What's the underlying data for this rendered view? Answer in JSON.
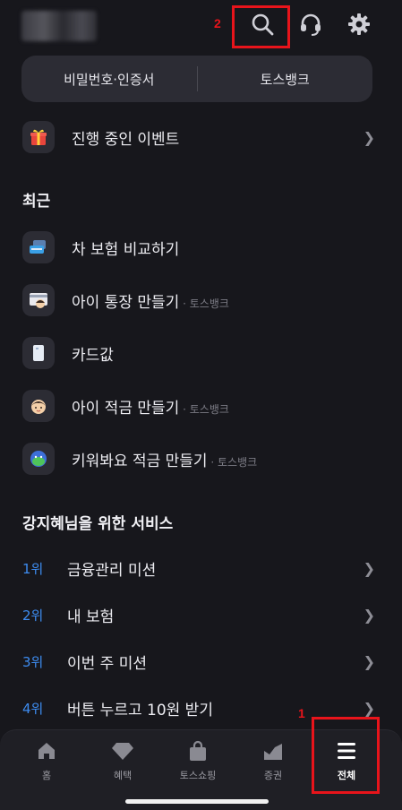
{
  "header": {
    "annotation_search": "2",
    "icons": [
      "search-icon",
      "headset-icon",
      "gear-icon"
    ]
  },
  "segment": {
    "left": "비밀번호·인증서",
    "right": "토스뱅크"
  },
  "events_row": {
    "label": "진행 중인 이벤트",
    "icon": "gift-icon"
  },
  "recent": {
    "title": "최근",
    "items": [
      {
        "label": "차 보험 비교하기",
        "sub": "",
        "icon": "car-insurance-icon"
      },
      {
        "label": "아이 통장 만들기",
        "sub": " · 토스뱅크",
        "icon": "kid-account-icon"
      },
      {
        "label": "카드값",
        "sub": "",
        "icon": "card-icon"
      },
      {
        "label": "아이 적금 만들기",
        "sub": " · 토스뱅크",
        "icon": "kid-face-icon"
      },
      {
        "label": "키워봐요 적금 만들기",
        "sub": " · 토스뱅크",
        "icon": "character-icon"
      }
    ]
  },
  "services": {
    "title": "강지혜님을 위한 서비스",
    "items": [
      {
        "rank": "1위",
        "label": "금융관리 미션"
      },
      {
        "rank": "2위",
        "label": "내 보험"
      },
      {
        "rank": "3위",
        "label": "이번 주 미션"
      },
      {
        "rank": "4위",
        "label": "버튼 누르고 10원 받기"
      }
    ]
  },
  "tabbar": {
    "annotation_all": "1",
    "tabs": [
      {
        "label": "홈",
        "icon": "home-icon"
      },
      {
        "label": "혜택",
        "icon": "diamond-icon"
      },
      {
        "label": "토스쇼핑",
        "icon": "shopping-bag-icon"
      },
      {
        "label": "증권",
        "icon": "stock-chart-icon"
      },
      {
        "label": "전체",
        "icon": "menu-icon"
      }
    ],
    "active": "전체"
  },
  "colors": {
    "background": "#17171c",
    "rank_blue": "#3d8cf0",
    "annotation_red": "#e8141b"
  }
}
